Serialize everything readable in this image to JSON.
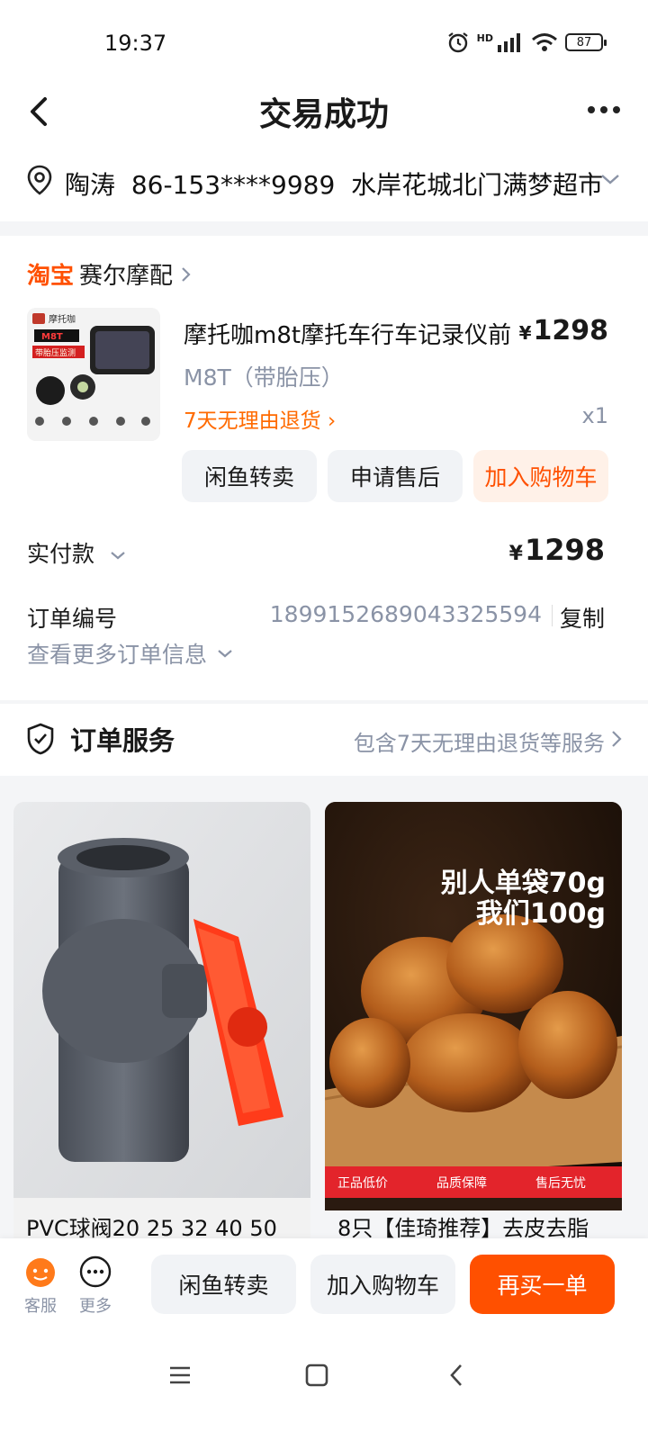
{
  "status_bar": {
    "time": "19:37",
    "battery": "87",
    "network": "HD"
  },
  "header": {
    "title": "交易成功"
  },
  "address": {
    "name": "陶涛",
    "phone": "86-153****9989",
    "location": "水岸花城北门满梦超市"
  },
  "shop": {
    "platform": "淘宝",
    "name": "赛尔摩配"
  },
  "product": {
    "title": "摩托咖m8t摩托车行车记录仪前",
    "price_symbol": "¥",
    "price": "1298",
    "sku": "M8T（带胎压）",
    "return_policy": "7天无理由退货",
    "quantity": "x1",
    "thumbnail_text": {
      "brand": "摩托咖",
      "model": "M8T",
      "feature": "带胎压监测"
    }
  },
  "card_buttons": {
    "resell": "闲鱼转卖",
    "after_sales": "申请售后",
    "add_cart": "加入购物车"
  },
  "payment": {
    "label": "实付款",
    "symbol": "¥",
    "amount": "1298"
  },
  "order": {
    "label": "订单编号",
    "number": "1899152689043325594",
    "copy": "复制",
    "more_info": "查看更多订单信息"
  },
  "service": {
    "title": "订单服务",
    "desc": "包含7天无理由退货等服务"
  },
  "recommendations": [
    {
      "name": "PVC球阀20 25 32 40 50"
    },
    {
      "name": "8只【佳琦推荐】去皮去脂",
      "overlay_line1": "别人单袋70g",
      "overlay_line2": "我们100g",
      "badges": [
        "正品低价",
        "品质保障",
        "售后无忧"
      ]
    }
  ],
  "bottom_bar": {
    "service": "客服",
    "more": "更多",
    "resell": "闲鱼转卖",
    "add_cart": "加入购物车",
    "buy_again": "再买一单"
  },
  "colors": {
    "accent": "#ff5000",
    "muted": "#8a93a6",
    "bg": "#f4f5f7"
  }
}
